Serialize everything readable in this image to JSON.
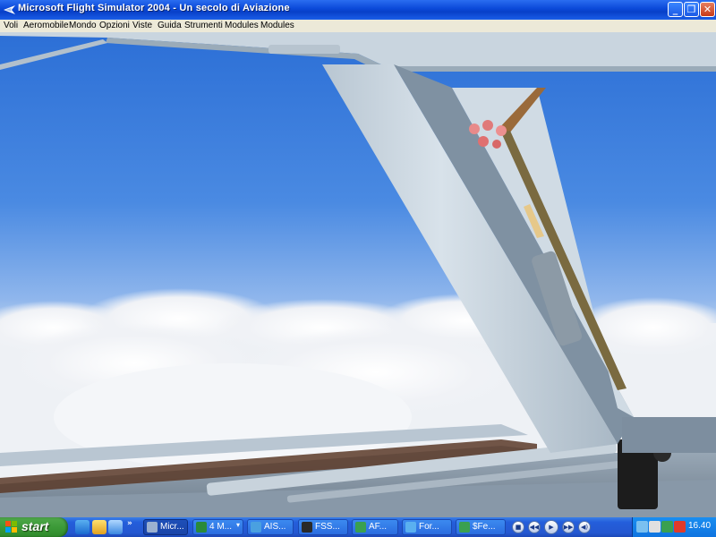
{
  "window": {
    "title": "Microsoft Flight Simulator 2004 - Un secolo di Aviazione",
    "controls": {
      "minimize": "_",
      "maximize": "❐",
      "close": "✕"
    }
  },
  "menu": [
    "Voli",
    "Aeromobile",
    "Mondo",
    "Opzioni",
    "Viste",
    "Guida",
    "Strumenti",
    "Modules",
    "Modules"
  ],
  "taskbar": {
    "start_label": "start",
    "quick_more": "»",
    "tasks": [
      {
        "label": "Micr...",
        "icon": "flight-sim-icon",
        "active": true,
        "arrow": ""
      },
      {
        "label": "4 M...",
        "icon": "excel-icon",
        "active": false,
        "arrow": "▾"
      },
      {
        "label": "AIS...",
        "icon": "globe-icon",
        "active": false,
        "arrow": ""
      },
      {
        "label": "FSS...",
        "icon": "monitor-icon",
        "active": false,
        "arrow": ""
      },
      {
        "label": "AF...",
        "icon": "airplane-icon",
        "active": false,
        "arrow": ""
      },
      {
        "label": "For...",
        "icon": "ie-icon",
        "active": false,
        "arrow": ""
      },
      {
        "label": "$Fe...",
        "icon": "app-icon",
        "active": false,
        "arrow": ""
      }
    ],
    "media_controls": [
      "■",
      "◀◀",
      "▶",
      "▶▶",
      "◀)"
    ],
    "tray_icons": [
      "network-icon",
      "volume-icon",
      "messenger-icon",
      "security-icon"
    ],
    "clock": "16.40"
  },
  "colors": {
    "title_blue": "#0840c8",
    "sky_top": "#2e72d8",
    "sky_horizon": "#bcd2ef",
    "cockpit_frame": "#cdd9e3",
    "taskbar_blue": "#245edb",
    "start_green": "#3c9a38"
  }
}
